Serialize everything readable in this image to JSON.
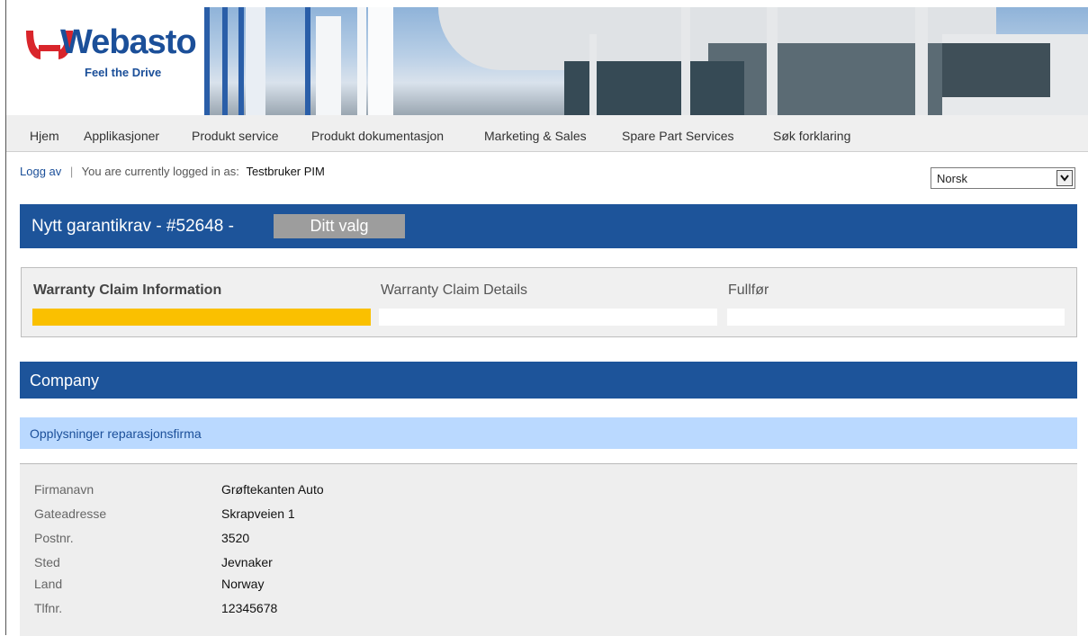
{
  "brand": {
    "logo_text": "Webasto",
    "slogan": "Feel the Drive",
    "colors": {
      "primary_blue": "#1d549a",
      "accent_yellow": "#fac000",
      "light_blue": "#bad9ff",
      "logo_red": "#d9252b"
    }
  },
  "nav": {
    "items": [
      "Hjem",
      "Applikasjoner",
      "Produkt service",
      "Produkt dokumentasjon",
      "Marketing & Sales",
      "Spare Part Services",
      "Søk forklaring"
    ]
  },
  "session": {
    "logout_label": "Logg av",
    "separator": "|",
    "logged_in_label": "You are currently logged in as:",
    "user_name": "Testbruker PIM"
  },
  "language": {
    "selected": "Norsk",
    "dropdown_icon": "chevron-down-icon"
  },
  "claim": {
    "title": "Nytt garantikrav  - #52648 -",
    "badge": "Ditt valg"
  },
  "steps": {
    "items": [
      {
        "label": "Warranty Claim Information",
        "active": true
      },
      {
        "label": "Warranty Claim Details",
        "active": false
      },
      {
        "label": "Fullfør",
        "active": false
      }
    ]
  },
  "company": {
    "section_title": "Company",
    "subsection_title": "Opplysninger reparasjonsfirma",
    "fields": [
      {
        "label": "Firmanavn",
        "value": "Grøftekanten Auto"
      },
      {
        "label": "Gateadresse",
        "value": "Skrapveien 1"
      },
      {
        "label": "Postnr.",
        "value": "3520"
      },
      {
        "label": "Sted",
        "value": "Jevnaker"
      },
      {
        "label": "Land",
        "value": "Norway"
      },
      {
        "label": "Tlfnr.",
        "value": "12345678"
      }
    ]
  }
}
